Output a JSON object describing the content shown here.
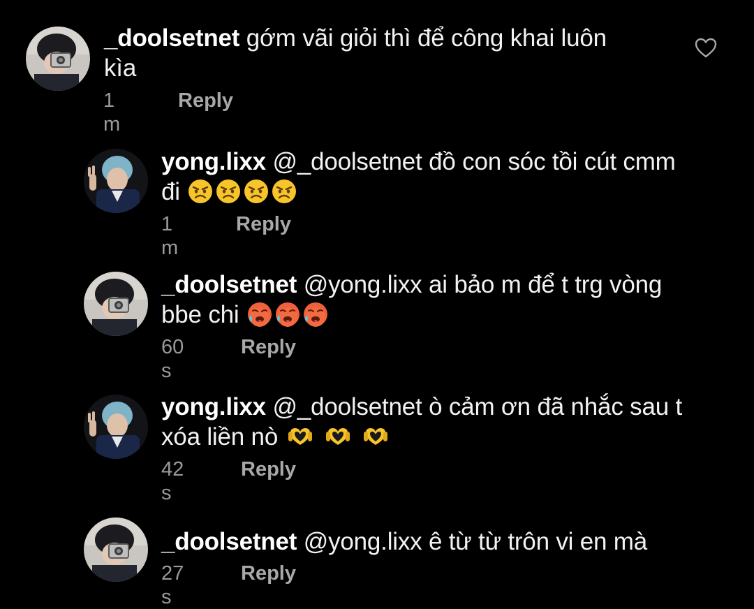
{
  "comments": [
    {
      "username": "_doolsetnet",
      "text": "gớm vãi giỏi thì để công khai luôn",
      "text_line2": "kìa",
      "time": "1 m",
      "reply_label": "Reply",
      "avatar": "doolsetnet-avatar"
    },
    {
      "username": "yong.lixx",
      "text": "@_doolsetnet đồ con sóc tồi cút cmm",
      "text_line2": "đi",
      "emojis": [
        "angry-face-icon",
        "angry-face-icon",
        "angry-face-icon",
        "angry-face-icon"
      ],
      "time": "1 m",
      "reply_label": "Reply",
      "avatar": "yonglixx-avatar"
    },
    {
      "username": "_doolsetnet",
      "text": "@yong.lixx ai bảo m để t trg vòng",
      "text_line2": "bbe chi",
      "emojis": [
        "hot-face-icon",
        "hot-face-icon",
        "hot-face-icon"
      ],
      "time": "60 s",
      "reply_label": "Reply",
      "avatar": "doolsetnet-avatar"
    },
    {
      "username": "yong.lixx",
      "text": "@_doolsetnet ò cảm ơn đã nhắc sau t",
      "text_line2": "xóa liền nò",
      "emojis": [
        "heart-hands-icon",
        "heart-hands-icon",
        "heart-hands-icon"
      ],
      "time": "42 s",
      "reply_label": "Reply",
      "avatar": "yonglixx-avatar"
    },
    {
      "username": "_doolsetnet",
      "text": "@yong.lixx ê từ từ trôn vi en mà",
      "time": "27 s",
      "reply_label": "Reply",
      "avatar": "doolsetnet-avatar"
    }
  ],
  "colors": {
    "background": "#000000",
    "text": "#f2f2f2",
    "meta": "#9a9a9a",
    "emoji_yellow": "#f7c52a",
    "emoji_red": "#f0603a"
  }
}
